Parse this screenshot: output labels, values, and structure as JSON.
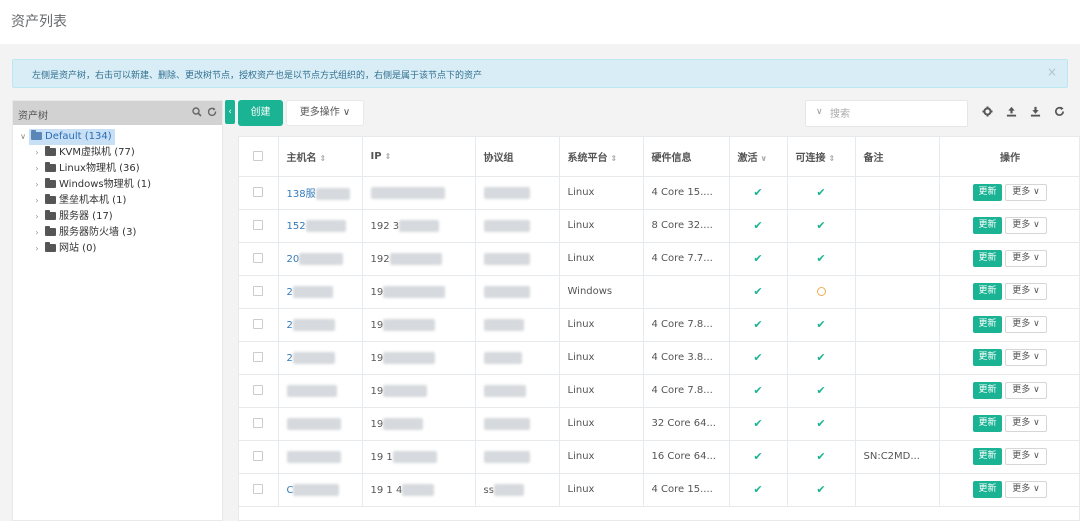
{
  "page": {
    "title": "资产列表"
  },
  "alert": {
    "text": "左侧是资产树，右击可以新建、删除、更改树节点，授权资产也是以节点方式组织的，右侧是属于该节点下的资产",
    "close": "×"
  },
  "tree": {
    "header": "资产树",
    "icons": {
      "search": "search-icon",
      "refresh": "refresh-icon"
    },
    "root": {
      "label": "Default (134)",
      "toggle": "∨"
    },
    "children": [
      {
        "label": "KVM虚拟机 (77)",
        "toggle": "›"
      },
      {
        "label": "Linux物理机 (36)",
        "toggle": "›"
      },
      {
        "label": "Windows物理机 (1)",
        "toggle": "›"
      },
      {
        "label": "堡垒机本机 (1)",
        "toggle": "›"
      },
      {
        "label": "服务器 (17)",
        "toggle": "›"
      },
      {
        "label": "服务器防火墙 (3)",
        "toggle": "›"
      },
      {
        "label": "网站 (0)",
        "toggle": "›"
      }
    ]
  },
  "toolbar": {
    "collapse": "‹",
    "create": "创建",
    "more_ops": "更多操作 ∨",
    "search_placeholder": "搜索",
    "search_chevron": "∨",
    "icons": [
      "gear-icon",
      "upload-icon",
      "download-icon",
      "refresh-icon"
    ]
  },
  "table": {
    "columns": {
      "hostname": "主机名",
      "ip": "IP",
      "protocol_group": "协议组",
      "platform": "系统平台",
      "hardware": "硬件信息",
      "active": "激活",
      "connectable": "可连接",
      "comment": "备注",
      "actions": "操作"
    },
    "sort_glyph": "⇕",
    "active_glyph": "∨",
    "update_label": "更新",
    "more_label": "更多 ∨",
    "rows": [
      {
        "host": "138服",
        "host_blur": 34,
        "ip": "",
        "ip_blur": 74,
        "proto_blur": 46,
        "platform": "Linux",
        "hardware": "4 Core 15....",
        "active": true,
        "conn": "ok",
        "comment": ""
      },
      {
        "host": "152",
        "host_blur": 40,
        "ip": "192  3",
        "ip_blur": 40,
        "proto_blur": 46,
        "platform": "Linux",
        "hardware": "8 Core 32....",
        "active": true,
        "conn": "ok",
        "comment": ""
      },
      {
        "host": "20",
        "host_blur": 44,
        "ip": "192",
        "ip_blur": 52,
        "proto_blur": 46,
        "platform": "Linux",
        "hardware": "4 Core 7.7...",
        "active": true,
        "conn": "ok",
        "comment": ""
      },
      {
        "host": "2",
        "host_blur": 40,
        "ip": "19",
        "ip_blur": 62,
        "proto_blur": 46,
        "platform": "Windows",
        "hardware": "",
        "active": true,
        "conn": "warn",
        "comment": ""
      },
      {
        "host": "2",
        "host_blur": 42,
        "ip": "19",
        "ip_blur": 52,
        "proto_blur": 40,
        "platform": "Linux",
        "hardware": "4 Core 7.8...",
        "active": true,
        "conn": "ok",
        "comment": ""
      },
      {
        "host": "2",
        "host_blur": 42,
        "ip": "19",
        "ip_blur": 52,
        "proto_blur": 38,
        "platform": "Linux",
        "hardware": "4 Core 3.8...",
        "active": true,
        "conn": "ok",
        "comment": ""
      },
      {
        "host": "",
        "host_blur": 50,
        "ip": "19",
        "ip_blur": 44,
        "proto_blur": 42,
        "platform": "Linux",
        "hardware": "4 Core 7.8...",
        "active": true,
        "conn": "ok",
        "comment": ""
      },
      {
        "host": "",
        "host_blur": 54,
        "ip": "19",
        "ip_blur": 40,
        "proto_blur": 46,
        "platform": "Linux",
        "hardware": "32 Core 64...",
        "active": true,
        "conn": "ok",
        "comment": ""
      },
      {
        "host": "",
        "host_blur": 54,
        "ip": "19  1",
        "ip_blur": 44,
        "proto_blur": 46,
        "platform": "Linux",
        "hardware": "16 Core 64...",
        "active": true,
        "conn": "ok",
        "comment": "SN:C2MD..."
      },
      {
        "host": "C",
        "host_blur": 46,
        "ip": "19  1  4",
        "ip_blur": 32,
        "proto": "ss",
        "proto_blur": 30,
        "platform": "Linux",
        "hardware": "4 Core 15....",
        "active": true,
        "conn": "ok",
        "comment": ""
      }
    ]
  }
}
